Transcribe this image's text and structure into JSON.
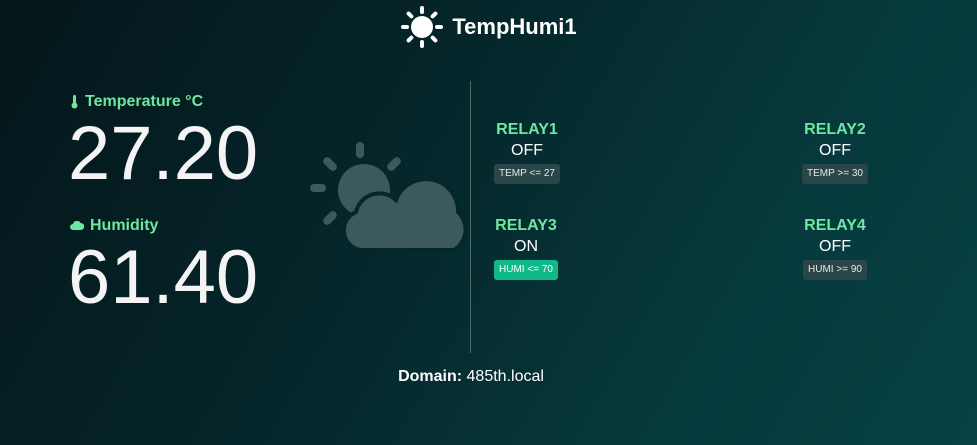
{
  "header": {
    "title": "TempHumi1",
    "logo_icon": "sun-icon"
  },
  "sensors": {
    "temperature": {
      "label": "Temperature °C",
      "icon": "thermometer-icon",
      "value": "27.20"
    },
    "humidity": {
      "label": "Humidity",
      "icon": "cloud-icon",
      "value": "61.40"
    }
  },
  "weather_icon": "partly-cloudy-icon",
  "relays": [
    {
      "name": "RELAY1",
      "state": "OFF",
      "rule": "TEMP <= 27",
      "active": false
    },
    {
      "name": "RELAY2",
      "state": "OFF",
      "rule": "TEMP >= 30",
      "active": false
    },
    {
      "name": "RELAY3",
      "state": "ON",
      "rule": "HUMI <= 70",
      "active": true
    },
    {
      "name": "RELAY4",
      "state": "OFF",
      "rule": "HUMI >= 90",
      "active": false
    }
  ],
  "footer": {
    "domain_label": "Domain:",
    "domain_value": "485th.local"
  },
  "colors": {
    "accent_green": "#6ee7a0",
    "active_badge": "#10b98a",
    "inactive_badge": "#2a4649",
    "background": "#05262a"
  }
}
